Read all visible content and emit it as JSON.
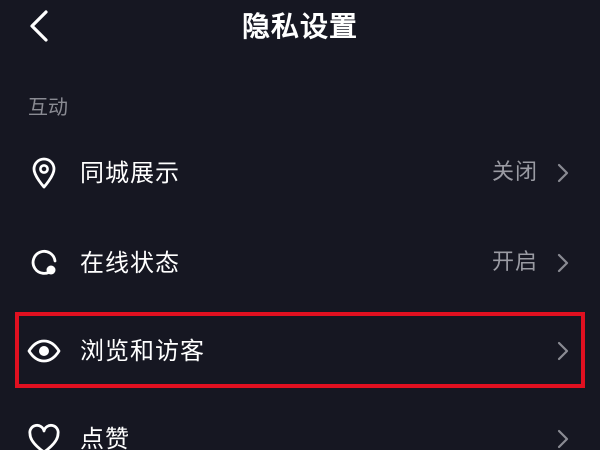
{
  "header": {
    "title": "隐私设置"
  },
  "section": {
    "label": "互动"
  },
  "items": [
    {
      "label": "同城展示",
      "value": "关闭",
      "icon": "location-pin-icon"
    },
    {
      "label": "在线状态",
      "value": "开启",
      "icon": "online-status-icon"
    },
    {
      "label": "浏览和访客",
      "value": "",
      "icon": "eye-icon"
    },
    {
      "label": "点赞",
      "value": "",
      "icon": "heart-icon"
    }
  ],
  "colors": {
    "background": "#161722",
    "text": "#ffffff",
    "muted_text": "#9a9ba3",
    "highlight": "#e01020"
  }
}
